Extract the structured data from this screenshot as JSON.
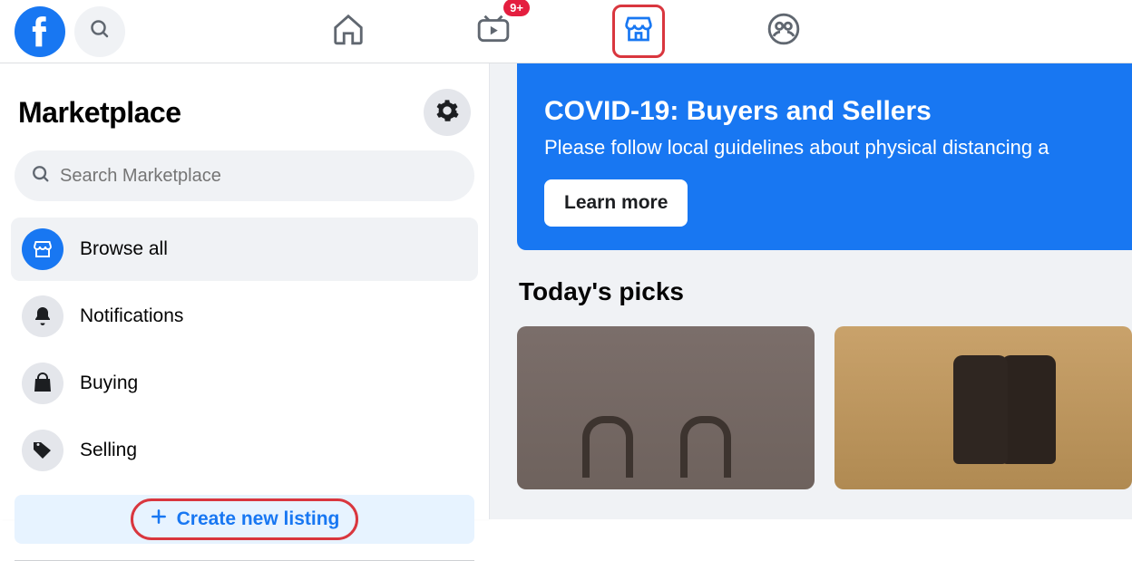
{
  "topnav": {
    "watch_badge": "9+"
  },
  "sidebar": {
    "title": "Marketplace",
    "search_placeholder": "Search Marketplace",
    "items": {
      "browse": "Browse all",
      "notifications": "Notifications",
      "buying": "Buying",
      "selling": "Selling"
    },
    "create_label": "Create new listing"
  },
  "banner": {
    "title": "COVID-19: Buyers and Sellers",
    "text": "Please follow local guidelines about physical distancing a",
    "button": "Learn more"
  },
  "main": {
    "picks_title": "Today's picks"
  }
}
